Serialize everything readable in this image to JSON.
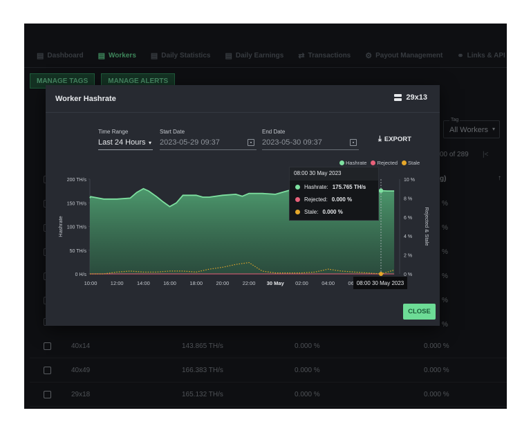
{
  "nav": {
    "items": [
      {
        "label": "Dashboard",
        "icon": "chart-icon"
      },
      {
        "label": "Workers",
        "icon": "server-icon"
      },
      {
        "label": "Daily Statistics",
        "icon": "bar-chart-icon"
      },
      {
        "label": "Daily Earnings",
        "icon": "coins-icon"
      },
      {
        "label": "Transactions",
        "icon": "swap-icon"
      },
      {
        "label": "Payout Management",
        "icon": "gear-icon"
      },
      {
        "label": "Links & API",
        "icon": "link-icon"
      }
    ]
  },
  "toolbar": {
    "manage_tags": "MANAGE TAGS",
    "manage_alerts": "MANAGE ALERTS"
  },
  "background": {
    "tag_label": "Tag",
    "tag_value": "All Workers",
    "pagination": "00 of 289",
    "avg_header": "g)",
    "rows": [
      {
        "name": "40x14",
        "hashrate": "143.865 TH/s",
        "rejected": "0.000 %",
        "stale": "0.000 %"
      },
      {
        "name": "40x49",
        "hashrate": "166.383 TH/s",
        "rejected": "0.000 %",
        "stale": "0.000 %"
      },
      {
        "name": "29x18",
        "hashrate": "165.132 TH/s",
        "rejected": "0.000 %",
        "stale": "0.000 %"
      }
    ],
    "partial_percent": "%"
  },
  "modal": {
    "title": "Worker Hashrate",
    "worker_id": "29x13",
    "time_range_label": "Time Range",
    "time_range_value": "Last 24 Hours",
    "start_label": "Start Date",
    "start_value": "2023-05-29 09:37",
    "end_label": "End Date",
    "end_value": "2023-05-30 09:37",
    "export_label": "EXPORT",
    "close_label": "CLOSE"
  },
  "tooltip": {
    "title": "08:00 30 May 2023",
    "rows": [
      {
        "label": "Hashrate:",
        "value": "175.765 TH/s",
        "color": "#7ee0a0"
      },
      {
        "label": "Rejected:",
        "value": "0.000 %",
        "color": "#e8617a"
      },
      {
        "label": "Stale:",
        "value": "0.000 %",
        "color": "#e5a72a"
      }
    ],
    "x_label": "08:00 30 May 2023"
  },
  "chart_data": {
    "type": "line",
    "x_labels": [
      "10:00",
      "12:00",
      "14:00",
      "16:00",
      "18:00",
      "20:00",
      "22:00",
      "30 May",
      "02:00",
      "04:00",
      "06:00",
      "08:00"
    ],
    "ylabel_left": "Hashrate",
    "ylabel_right": "Rejected & Stale",
    "y_left_ticks": [
      "0 H/s",
      "50 TH/s",
      "100 TH/s",
      "150 TH/s",
      "200 TH/s"
    ],
    "y_right_ticks": [
      "0 %",
      "2 %",
      "4 %",
      "6 %",
      "8 %",
      "10 %"
    ],
    "ylim_left": [
      0,
      200
    ],
    "ylim_right": [
      0,
      10
    ],
    "legend": [
      "Hashrate",
      "Rejected",
      "Stale"
    ],
    "colors": {
      "Hashrate": "#7ee0a0",
      "Rejected": "#e8617a",
      "Stale": "#e5a72a"
    },
    "series": [
      {
        "name": "Hashrate",
        "x": [
          9.6,
          10,
          11,
          12,
          13,
          13.5,
          14,
          14.4,
          15,
          15.5,
          16,
          16.5,
          17,
          18,
          18.5,
          19,
          20,
          21,
          21.5,
          22,
          23,
          24,
          25,
          26,
          27,
          28,
          29,
          30,
          31,
          32,
          32.5,
          33
        ],
        "values": [
          160,
          163,
          158,
          158,
          160,
          172,
          180,
          175,
          163,
          152,
          142,
          150,
          166,
          166,
          162,
          162,
          166,
          168,
          164,
          170,
          170,
          168,
          176,
          171,
          172,
          172,
          173,
          173,
          174,
          175.8,
          175,
          175
        ]
      },
      {
        "name": "Rejected",
        "x": [
          9.6,
          33
        ],
        "values": [
          0,
          0
        ]
      },
      {
        "name": "Stale",
        "x": [
          9.6,
          10,
          11,
          12,
          13,
          14,
          15,
          16,
          17,
          18,
          19,
          20,
          21,
          22,
          23,
          24,
          25,
          26,
          27,
          28,
          29,
          30,
          31,
          32,
          33
        ],
        "values": [
          0,
          0,
          0,
          0.2,
          0.3,
          0.2,
          0.2,
          0.3,
          0.3,
          0.2,
          0.5,
          0.7,
          1.0,
          1.2,
          0.3,
          0.1,
          0.1,
          0.1,
          0.2,
          0.5,
          0.3,
          0.2,
          0.1,
          0,
          0.4
        ]
      }
    ]
  }
}
